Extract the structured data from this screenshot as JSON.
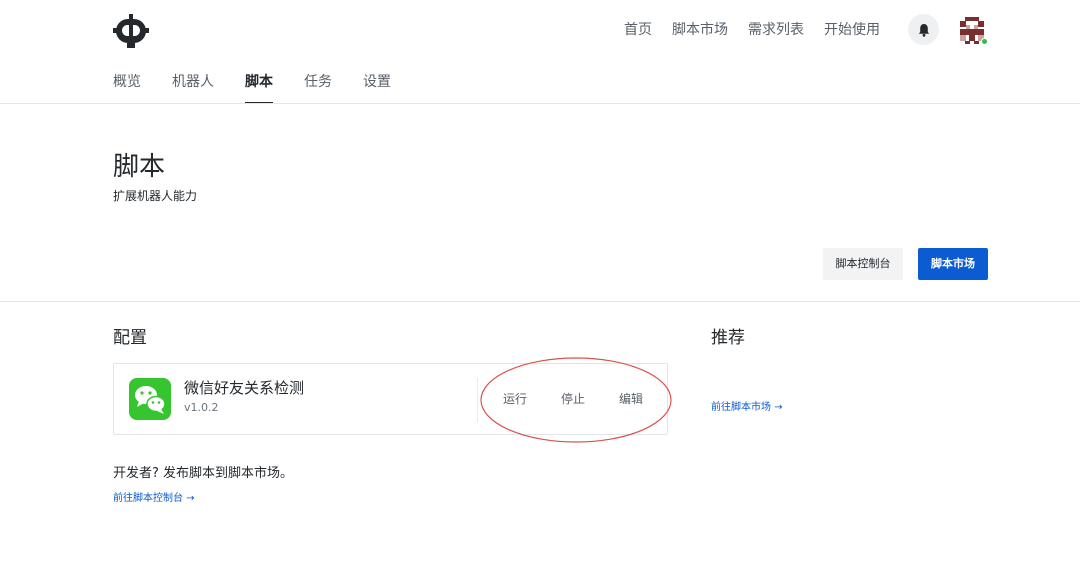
{
  "header": {
    "logo": "robot-logo-icon",
    "nav": [
      "首页",
      "脚本市场",
      "需求列表",
      "开始使用"
    ],
    "notification_icon": "bell-icon",
    "avatar": "avatar-icon"
  },
  "subnav": {
    "items": [
      "概览",
      "机器人",
      "脚本",
      "任务",
      "设置"
    ],
    "active": "脚本"
  },
  "page": {
    "title": "脚本",
    "subtitle": "扩展机器人能力"
  },
  "buttons": {
    "console": "脚本控制台",
    "market": "脚本市场"
  },
  "config": {
    "heading": "配置",
    "script": {
      "icon": "wechat-icon",
      "name": "微信好友关系检测",
      "version": "v1.0.2",
      "actions": [
        "运行",
        "停止",
        "编辑"
      ]
    }
  },
  "recommend": {
    "heading": "推荐",
    "link": "前往脚本市场 →"
  },
  "developer": {
    "text": "开发者? 发布脚本到脚本市场。",
    "link": "前往脚本控制台 →"
  },
  "colors": {
    "primary": "#0b5bd1",
    "wechat_green": "#36c52f",
    "annotation_red": "#d9534f",
    "online_dot": "#2cbe4e"
  }
}
